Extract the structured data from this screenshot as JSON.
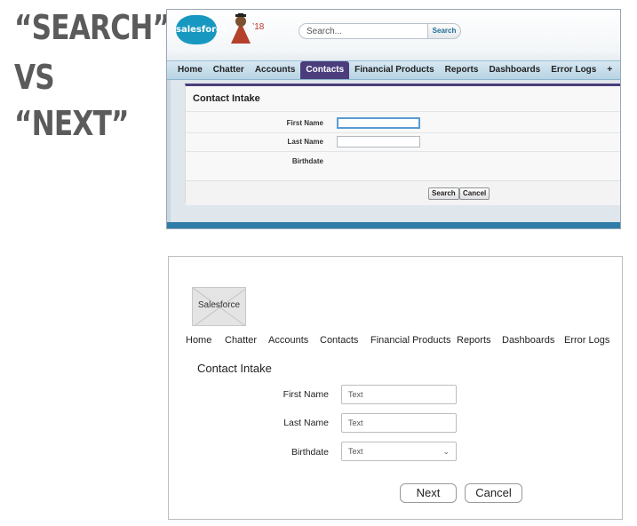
{
  "heading": {
    "line1": "“SEARCH”",
    "line2": "VS",
    "line3": "“NEXT”"
  },
  "salesforce": {
    "logo_text": "salesforce",
    "mascot_year": "’18",
    "search_placeholder": "Search...",
    "search_button": "Search",
    "tabs": [
      {
        "label": "Home"
      },
      {
        "label": "Chatter"
      },
      {
        "label": "Accounts"
      },
      {
        "label": "Contacts"
      },
      {
        "label": "Financial Products"
      },
      {
        "label": "Reports"
      },
      {
        "label": "Dashboards"
      },
      {
        "label": "Error Logs"
      },
      {
        "label": "+"
      }
    ],
    "active_tab": "Contacts",
    "panel_title": "Contact Intake",
    "fields": [
      {
        "label": "First Name",
        "value": ""
      },
      {
        "label": "Last Name",
        "value": ""
      },
      {
        "label": "Birthdate"
      }
    ],
    "buttons": {
      "search": "Search",
      "cancel": "Cancel"
    },
    "colors": {
      "accent": "#4b3d7c",
      "brand": "#1798c1",
      "tab_bar": "#b7d3e3"
    }
  },
  "wireframe": {
    "logo_text": "Salesforce",
    "nav": [
      {
        "label": "Home"
      },
      {
        "label": "Chatter"
      },
      {
        "label": "Accounts"
      },
      {
        "label": "Contacts"
      },
      {
        "label": "Financial Products"
      },
      {
        "label": "Reports"
      },
      {
        "label": "Dashboards"
      },
      {
        "label": "Error Logs"
      }
    ],
    "title": "Contact Intake",
    "fields": [
      {
        "label": "First Name",
        "placeholder": "Text"
      },
      {
        "label": "Last Name",
        "placeholder": "Text"
      },
      {
        "label": "Birthdate",
        "placeholder": "Text"
      }
    ],
    "buttons": {
      "next": "Next",
      "cancel": "Cancel"
    }
  }
}
